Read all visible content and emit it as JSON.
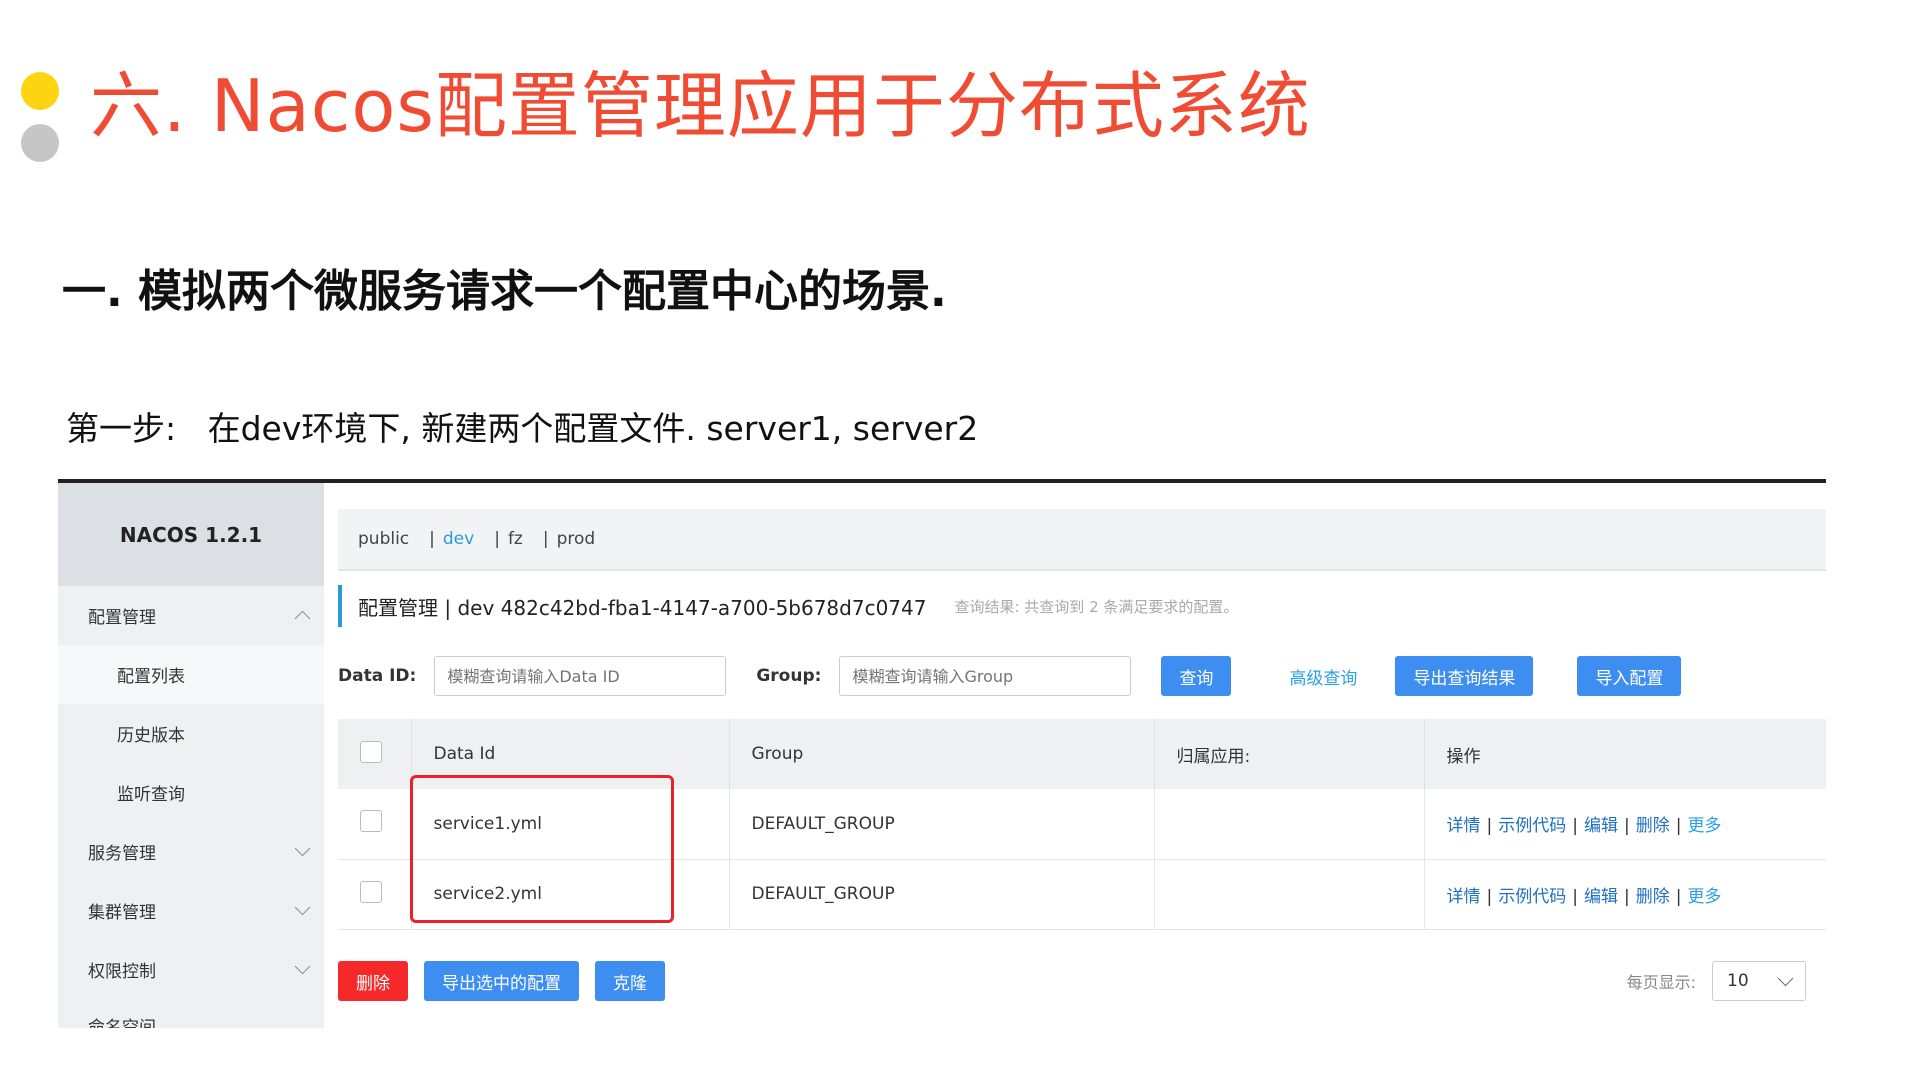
{
  "slide": {
    "title": "六. Nacos配置管理应用于分布式系统",
    "subtitle": "一. 模拟两个微服务请求一个配置中心的场景.",
    "step_label": "第一步:",
    "step_text": "在dev环境下, 新建两个配置文件. server1, server2"
  },
  "nacos": {
    "brand": "NACOS 1.2.1",
    "sidebar": [
      {
        "label": "配置管理",
        "expanded": true
      },
      {
        "label": "配置列表",
        "sub": true,
        "active": true
      },
      {
        "label": "历史版本",
        "sub": true
      },
      {
        "label": "监听查询",
        "sub": true
      },
      {
        "label": "服务管理"
      },
      {
        "label": "集群管理"
      },
      {
        "label": "权限控制"
      },
      {
        "label": "命名空间"
      }
    ],
    "namespaces": [
      "public",
      "dev",
      "fz",
      "prod"
    ],
    "active_namespace": "dev",
    "page_title": "配置管理 | dev 482c42bd-fba1-4147-a700-5b678d7c0747",
    "result_hint": "查询结果: 共查询到 2 条满足要求的配置。",
    "filters": {
      "dataid_label": "Data ID:",
      "dataid_placeholder": "模糊查询请输入Data ID",
      "group_label": "Group:",
      "group_placeholder": "模糊查询请输入Group",
      "query_btn": "查询",
      "advanced_link": "高级查询",
      "export_btn": "导出查询结果",
      "import_btn": "导入配置"
    },
    "table": {
      "headers": [
        "Data Id",
        "Group",
        "归属应用:",
        "操作"
      ],
      "rows": [
        {
          "data_id": "service1.yml",
          "group": "DEFAULT_GROUP",
          "app": ""
        },
        {
          "data_id": "service2.yml",
          "group": "DEFAULT_GROUP",
          "app": ""
        }
      ],
      "ops": [
        "详情",
        "示例代码",
        "编辑",
        "删除",
        "更多"
      ]
    },
    "footer": {
      "delete_btn": "删除",
      "export_selected_btn": "导出选中的配置",
      "clone_btn": "克隆",
      "page_size_label": "每页显示:",
      "page_size": "10"
    },
    "colors": {
      "accent": "#3d8ef0",
      "danger": "#f5282a",
      "title": "#f04b33",
      "highlight": "#e8222a"
    }
  }
}
